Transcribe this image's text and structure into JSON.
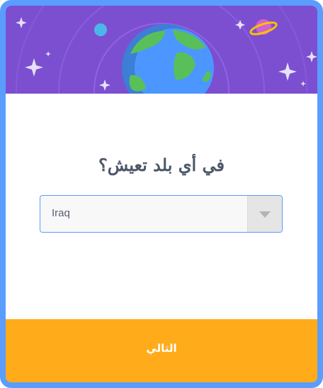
{
  "dialog": {
    "question": "في أي بلد تعيش؟",
    "country_select": {
      "value": "Iraq"
    },
    "next_button_label": "التالي"
  },
  "colors": {
    "frame": "#5b9cff",
    "header_bg": "#7b4fd0",
    "footer_bg": "#ffab1a",
    "question_text": "#4c5768"
  },
  "icons": [
    "globe-illustration",
    "planet-icon",
    "moon-icon",
    "star-icon",
    "chevron-down-icon"
  ]
}
